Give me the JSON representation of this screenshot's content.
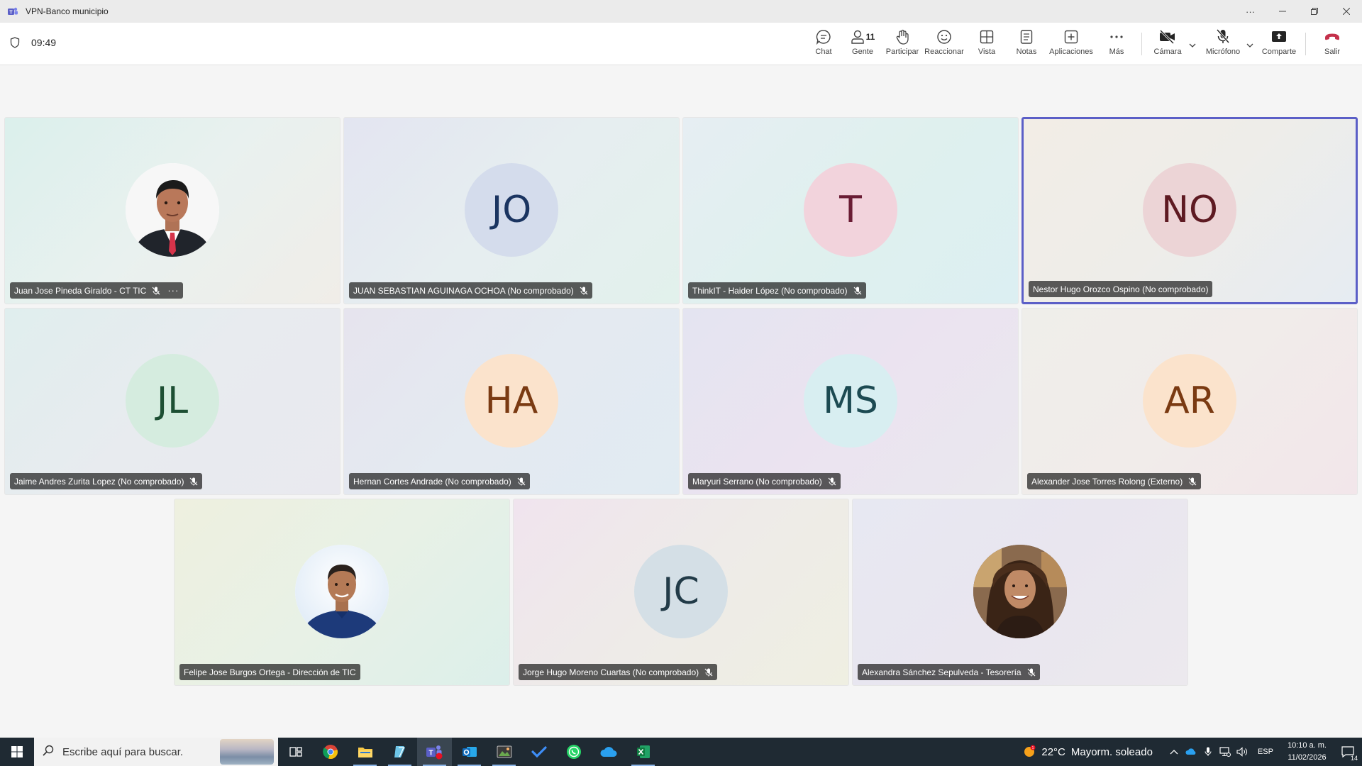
{
  "window": {
    "title": "VPN-Banco municipio",
    "controls": [
      "more-options",
      "minimize",
      "restore",
      "close"
    ]
  },
  "meeting": {
    "timer": "09:49",
    "toolbar": {
      "chat": "Chat",
      "people": "Gente",
      "people_count": "11",
      "raise": "Participar",
      "react": "Reaccionar",
      "view": "Vista",
      "notes": "Notas",
      "apps": "Aplicaciones",
      "more": "Más",
      "camera": "Cámara",
      "mic": "Micrófono",
      "share": "Comparte",
      "leave": "Salir"
    },
    "colors": {
      "accent": "#5b5fc7",
      "leave": "#c4314b"
    },
    "participants": [
      {
        "name": "Juan Jose Pineda Giraldo - CT TIC",
        "initials": "",
        "photo": "person-photo-man-suit",
        "muted": true,
        "more": "···"
      },
      {
        "name": "JUAN SEBASTIAN AGUINAGA OCHOA (No comprobado)",
        "initials": "JO",
        "muted": true
      },
      {
        "name": "ThinkIT - Haider López (No comprobado)",
        "initials": "T",
        "muted": true
      },
      {
        "name": "Nestor Hugo Orozco Ospino (No comprobado)",
        "initials": "NO",
        "muted": false,
        "active": true
      },
      {
        "name": "Jaime Andres Zurita Lopez (No comprobado)",
        "initials": "JL",
        "muted": true
      },
      {
        "name": "Hernan Cortes Andrade (No comprobado)",
        "initials": "HA",
        "muted": true
      },
      {
        "name": "Maryuri Serrano (No comprobado)",
        "initials": "MS",
        "muted": true
      },
      {
        "name": "Alexander Jose Torres Rolong (Externo)",
        "initials": "AR",
        "muted": true
      },
      {
        "name": "Felipe Jose Burgos Ortega - Dirección de TIC",
        "initials": "",
        "photo": "person-photo-man-blue-shirt",
        "muted": false
      },
      {
        "name": "Jorge Hugo Moreno Cuartas (No comprobado)",
        "initials": "JC",
        "muted": true
      },
      {
        "name": "Alexandra Sánchez Sepulveda - Tesorería",
        "initials": "",
        "photo": "person-photo-woman-curly-hair",
        "muted": true
      }
    ]
  },
  "taskbar": {
    "search_placeholder": "Escribe aquí para buscar.",
    "apps": [
      "task-view",
      "chrome",
      "file-explorer",
      "notepad",
      "teams",
      "outlook",
      "snipping-tool",
      "todo",
      "whatsapp",
      "onedrive",
      "excel"
    ],
    "weather": {
      "temp": "22°C",
      "desc": "Mayorm. soleado"
    },
    "language": "ESP",
    "time": "10:10 a. m.",
    "date": "11/02/2026",
    "notifications": "14"
  }
}
